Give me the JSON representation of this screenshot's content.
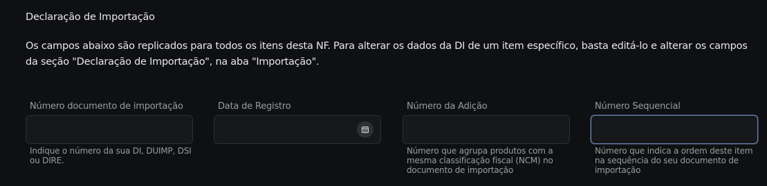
{
  "section": {
    "title": "Declaração de Importação",
    "description": "Os campos abaixo são replicados para todos os itens desta NF. Para alterar os dados da DI de um item específico, basta editá-lo e alterar os campos da seção \"Declaração de Importação\", na aba \"Importação\"."
  },
  "fields": [
    {
      "label": "Número documento de importação",
      "value": "",
      "helper": "Indique o número da sua DI, DUIMP, DSI ou DIRE."
    },
    {
      "label": "Data de Registro",
      "value": "",
      "icon": "calendar-icon"
    },
    {
      "label": "Número da Adição",
      "value": "",
      "helper": "Número que agrupa produtos com a mesma classificação fiscal (NCM) no documento de importação"
    },
    {
      "label": "Número Sequencial",
      "value": "",
      "focused": true,
      "helper": "Número que indica a ordem deste item na sequência do seu documento de importação"
    }
  ],
  "colors": {
    "background": "#0f1012",
    "input_background": "#17181b",
    "input_border": "#2c2e33",
    "focus_border": "#6e88b5",
    "primary_text": "#e8e8ea",
    "secondary_text": "#9a9ca3"
  }
}
